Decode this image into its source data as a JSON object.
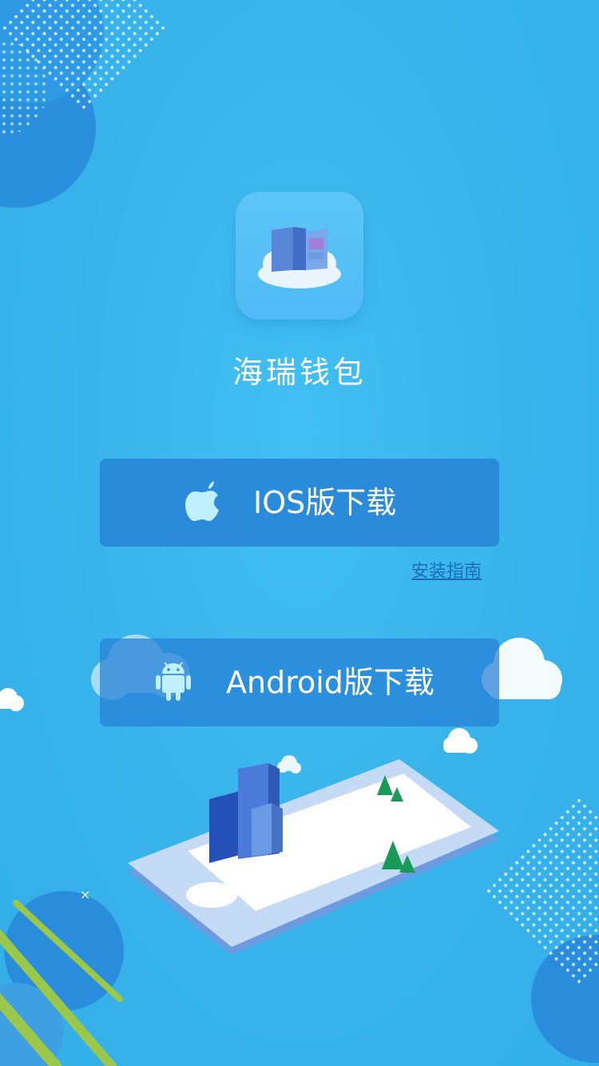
{
  "app": {
    "name": "海瑞钱包"
  },
  "buttons": {
    "ios_label": "IOS版下载",
    "android_label": "Android版下载"
  },
  "links": {
    "install_guide": "安装指南"
  },
  "icons": {
    "app_logo": "building-on-cloud-icon",
    "ios": "apple-icon",
    "android": "android-icon"
  },
  "colors": {
    "background": "#3ab6ec",
    "button": "#2780d6",
    "app_icon": "#55c0f6",
    "link": "#1c6cb8"
  }
}
